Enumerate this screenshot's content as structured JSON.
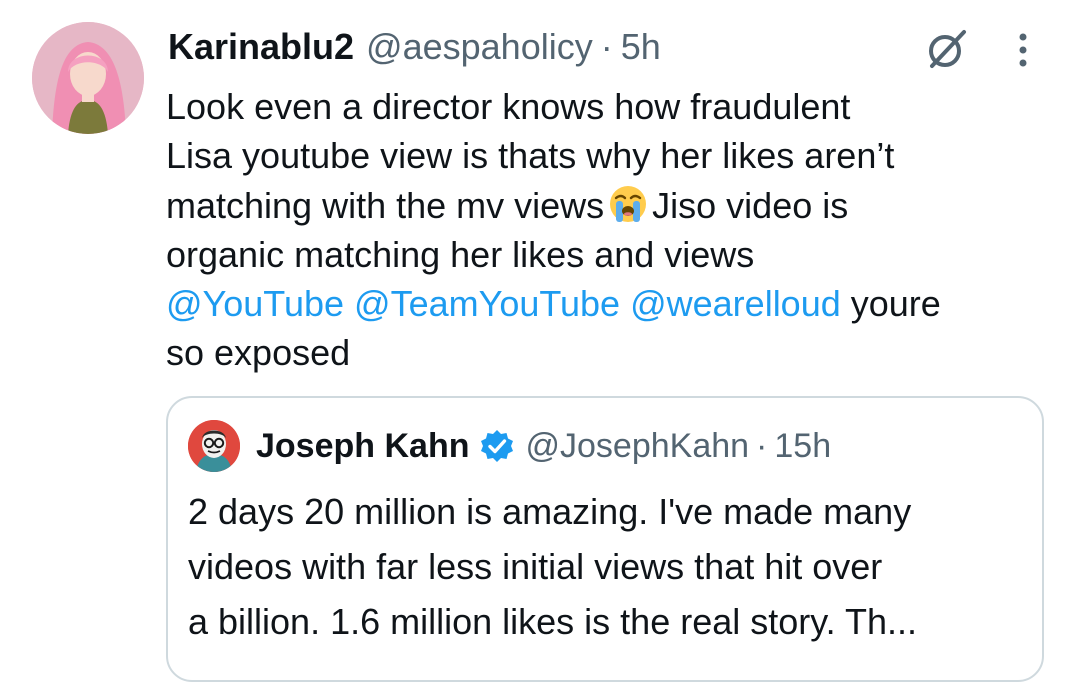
{
  "tweet": {
    "display_name": "Karinablu2",
    "handle": "@aespaholicy",
    "separator": "·",
    "time": "5h",
    "icons": {
      "avatar": "profile-photo",
      "grok": "grok-icon",
      "more": "more-vertical-icon"
    },
    "body": {
      "line1": "Look even a director knows how fraudulent",
      "line2": "Lisa youtube view is thats why her likes aren’t",
      "line3_a": "matching with the mv views",
      "emoji": "😭",
      "line3_b": "Jiso video is",
      "line4": "organic matching her likes and views",
      "mention1": "@YouTube",
      "mention2": "@TeamYouTube",
      "mention3": "@wearelloud",
      "line5_tail": "youre",
      "line6": "so exposed"
    }
  },
  "quote": {
    "display_name": "Joseph Kahn",
    "handle": "@JosephKahn",
    "separator": "·",
    "time": "15h",
    "verified_icon": "verified-badge-icon",
    "text": {
      "line1": "2 days 20 million is amazing. I've made many",
      "line2": "videos with far less initial views that hit over",
      "line3": "a billion. 1.6 million likes is the real story. Th..."
    }
  },
  "colors": {
    "text_primary": "#0f1419",
    "text_secondary": "#536471",
    "link": "#1d9bf0",
    "border": "#cfd9de",
    "background": "#ffffff"
  }
}
